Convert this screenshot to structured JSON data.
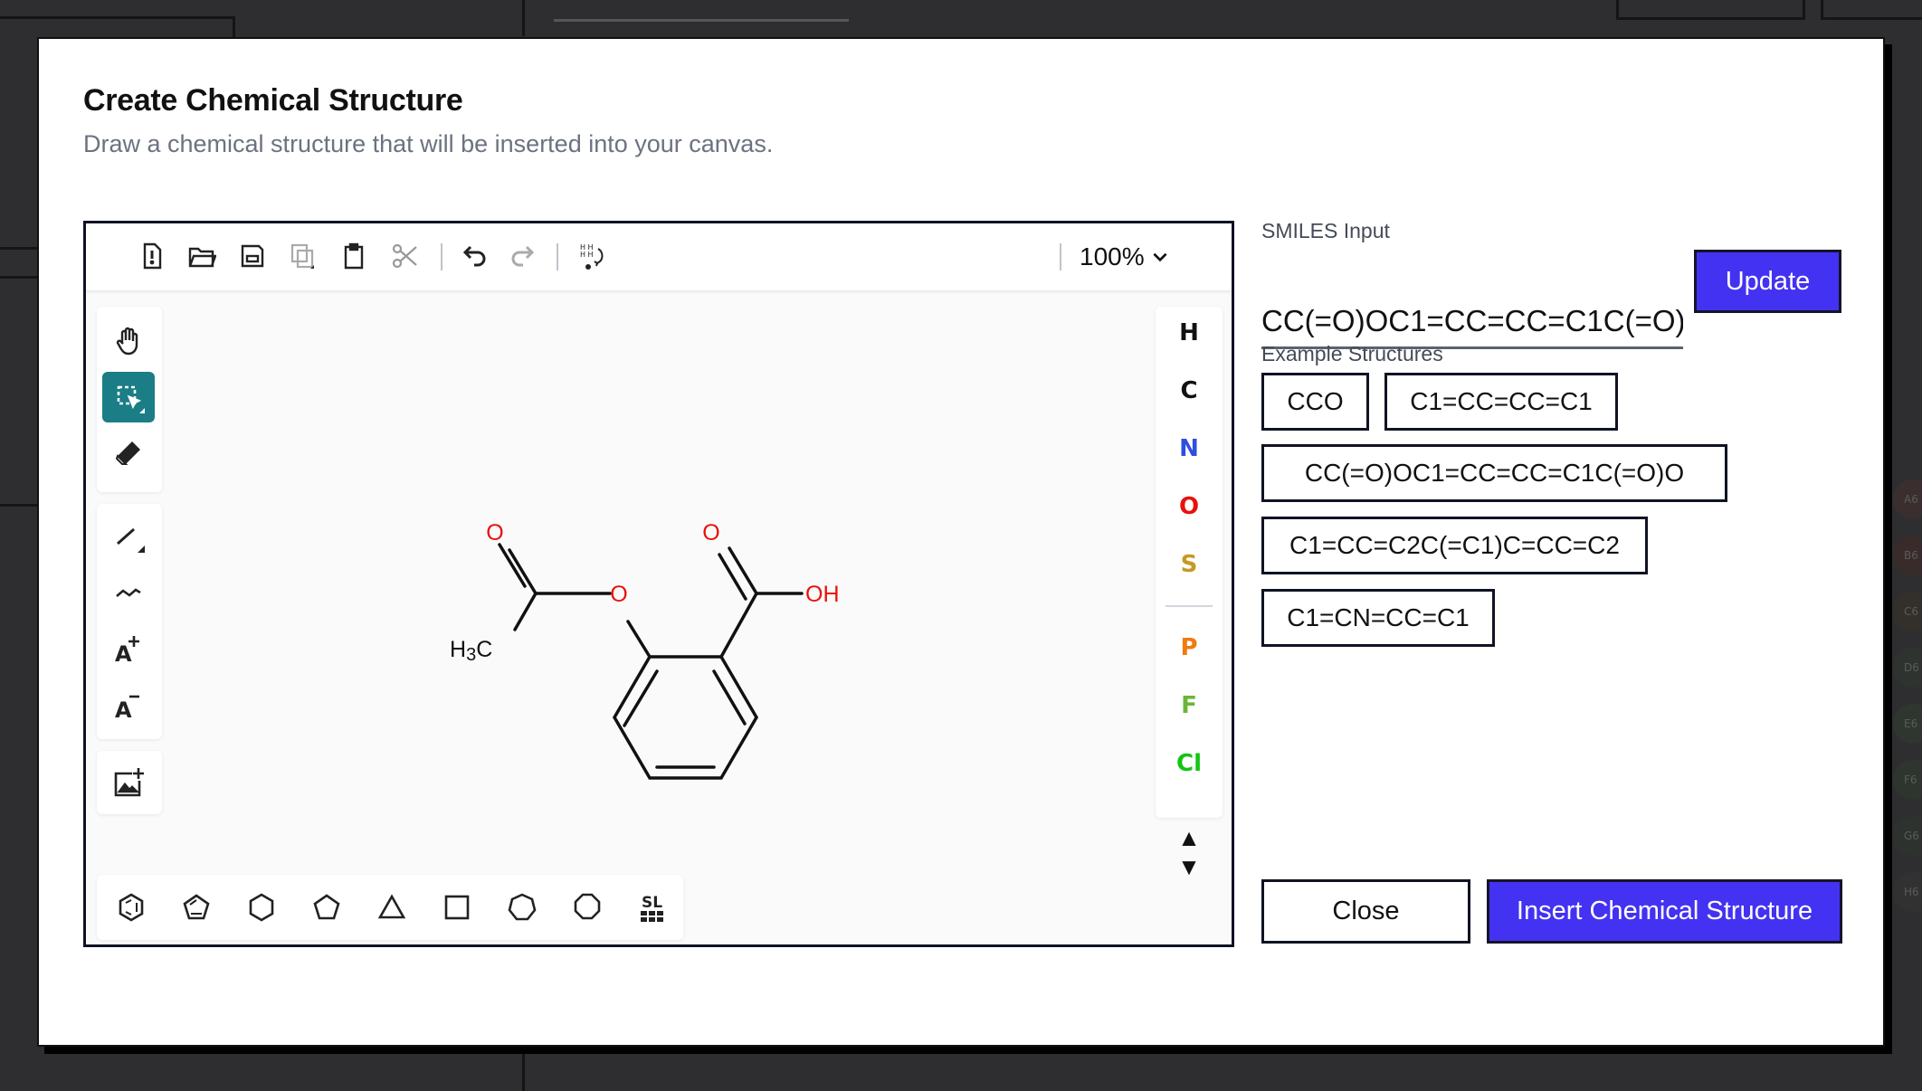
{
  "modal": {
    "title": "Create Chemical Structure",
    "subtitle": "Draw a chemical structure that will be inserted into your canvas."
  },
  "editor": {
    "top_toolbar": {
      "zoom_level": "100%",
      "icons": [
        "new-file-icon",
        "open-folder-icon",
        "save-icon",
        "copy-icon",
        "paste-icon",
        "cut-icon",
        "undo-icon",
        "redo-icon",
        "explicit-hydrogens-icon"
      ]
    },
    "left_toolbar": {
      "icons": [
        "hand-icon",
        "selection-icon",
        "eraser-icon",
        "bond-icon",
        "chain-icon",
        "charge-plus-icon",
        "charge-minus-icon",
        "add-image-icon"
      ]
    },
    "atom_palette": {
      "atoms": [
        {
          "symbol": "H",
          "color": "#111111"
        },
        {
          "symbol": "C",
          "color": "#111111"
        },
        {
          "symbol": "N",
          "color": "#2f4ee0"
        },
        {
          "symbol": "O",
          "color": "#e8120c"
        },
        {
          "symbol": "S",
          "color": "#c59a24"
        },
        {
          "symbol": "P",
          "color": "#f07b10"
        },
        {
          "symbol": "F",
          "color": "#6bb53a"
        },
        {
          "symbol": "Cl",
          "color": "#14c414"
        }
      ]
    },
    "molecule": {
      "labels": {
        "o_ketone": "O",
        "o_ester": "O",
        "o_acid": "O",
        "oh": "OH",
        "methyl_h": "H",
        "methyl_sub": "3",
        "methyl_c": "C"
      },
      "colors": {
        "oxygen": "#e8120c",
        "bond": "#111111"
      }
    },
    "bottom_toolbar": {
      "shapes": [
        "benzene-icon",
        "cyclopentadiene-icon",
        "cyclohexane-icon",
        "cyclopentane-icon",
        "cyclopropane-icon",
        "cyclobutane-icon",
        "cycloheptane-icon",
        "cyclooctane-icon",
        "structure-library-icon"
      ],
      "library_label": "SL"
    }
  },
  "smiles": {
    "label": "SMILES Input",
    "value": "CC(=O)OC1=CC=CC=C1C(=O)O",
    "update_label": "Update"
  },
  "examples": {
    "label": "Example Structures",
    "items": [
      "CCO",
      "C1=CC=CC=C1",
      "CC(=O)OC1=CC=CC=C1C(=O)O",
      "C1=CC=C2C(=C1)C=CC=C2",
      "C1=CN=CC=C1"
    ]
  },
  "actions": {
    "close_label": "Close",
    "insert_label": "Insert Chemical Structure"
  },
  "backdrop": {
    "well_labels": [
      "A6",
      "B6",
      "C6",
      "D6",
      "E6",
      "F6",
      "G6",
      "H6"
    ],
    "well_colors": [
      "#3a2e2e",
      "#3a2b2b",
      "#332f2b",
      "#2f3330",
      "#2e362f",
      "#2d352e",
      "#2d322e",
      "#313131"
    ]
  },
  "colors": {
    "accent": "#4432f2",
    "active_tool": "#1b7d86"
  }
}
